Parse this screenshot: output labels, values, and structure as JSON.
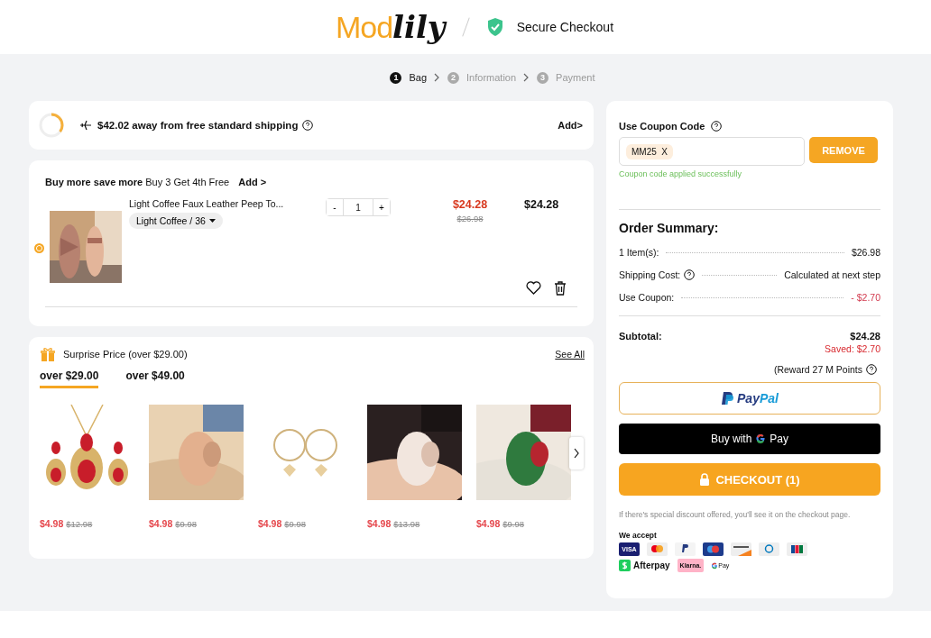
{
  "header": {
    "logo_a": "Mod",
    "logo_b": "lily",
    "secure": "Secure Checkout"
  },
  "steps": [
    {
      "num": "1",
      "label": "Bag",
      "active": true
    },
    {
      "num": "2",
      "label": "Information",
      "active": false
    },
    {
      "num": "3",
      "label": "Payment",
      "active": false
    }
  ],
  "shipping": {
    "level": 0.35,
    "text": "$42.02 away from free standard shipping",
    "link": "Add>"
  },
  "bag": {
    "promo_bold": "Buy more save more",
    "promo": "Buy 3 Get 4th Free",
    "promo_link": "Add >",
    "item": {
      "selected": true,
      "name": "Light Coffee Faux Leather Peep To...",
      "variant": "Light Coffee / 36",
      "minus": "-",
      "qty": "1",
      "plus": "+",
      "price": "$24.28",
      "old_price": "$26.98",
      "total": "$24.28"
    }
  },
  "surprise": {
    "title": "Surprise Price (over $29.00)",
    "see_all": "See All",
    "tabs": [
      {
        "label": "over $29.00",
        "selected": true
      },
      {
        "label": "over $49.00",
        "selected": false
      }
    ],
    "products": [
      {
        "kind": "jewelry",
        "price": "$4.98",
        "old_price": "$12.98"
      },
      {
        "price": "$4.98",
        "old_price": "$9.98"
      },
      {
        "kind": "earrings",
        "price": "$4.98",
        "old_price": "$9.98"
      },
      {
        "price": "$4.98",
        "old_price": "$13.98"
      },
      {
        "price": "$4.98",
        "old_price": "$9.98"
      }
    ]
  },
  "coupon": {
    "label": "Use Coupon Code",
    "code": "MM25",
    "remove_x": "X",
    "button": "REMOVE",
    "message": "Coupon code applied successfully"
  },
  "summary": {
    "title": "Order Summary:",
    "rows": [
      {
        "label": "1 Item(s):",
        "help": false,
        "value": "$26.98",
        "discount": false
      },
      {
        "label": "Shipping Cost:",
        "help": true,
        "value": "Calculated at next step",
        "discount": false
      },
      {
        "label": "Use Coupon:",
        "help": false,
        "value": "- $2.70",
        "discount": true
      }
    ],
    "subtotal_label": "Subtotal:",
    "subtotal": "$24.28",
    "saved": "Saved: $2.70",
    "reward": "(Reward 27 M Points"
  },
  "paypal": {
    "a": "Pay",
    "b": "Pal"
  },
  "gpay": {
    "prefix": "Buy with",
    "suffix": "Pay"
  },
  "checkout": "CHECKOUT (1)",
  "note": "If there's special discount offered, you'll see it on the checkout page.",
  "accept": {
    "title": "We accept",
    "methods": [
      {
        "kind": "visa",
        "label": "VISA"
      },
      {
        "kind": "mastercard"
      },
      {
        "kind": "paypal"
      },
      {
        "kind": "maestro"
      },
      {
        "kind": "discover"
      },
      {
        "kind": "diners"
      },
      {
        "kind": "jcb"
      },
      {
        "kind": "afterpay",
        "label": "Afterpay"
      },
      {
        "kind": "klarna",
        "label": "Klarna."
      },
      {
        "kind": "gpay",
        "label": "Pay"
      }
    ]
  }
}
